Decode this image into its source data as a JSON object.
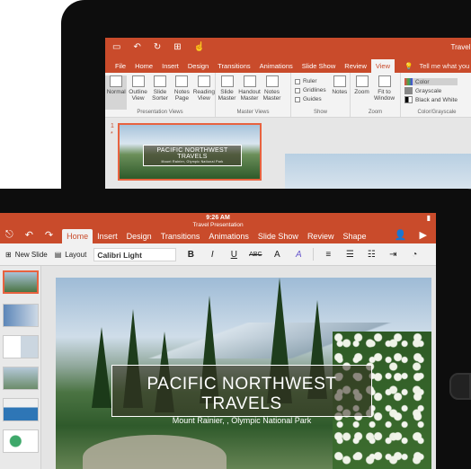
{
  "back": {
    "doc_title": "Travel P",
    "tabs": [
      "File",
      "Home",
      "Insert",
      "Design",
      "Transitions",
      "Animations",
      "Slide Show",
      "Review",
      "View"
    ],
    "active_tab": "View",
    "tell_me": "Tell me what you",
    "groups": {
      "presentation_views": {
        "label": "Presentation Views",
        "commands": [
          "Normal",
          "Outline View",
          "Slide Sorter",
          "Notes Page",
          "Reading View"
        ]
      },
      "master_views": {
        "label": "Master Views",
        "commands": [
          "Slide Master",
          "Handout Master",
          "Notes Master"
        ]
      },
      "show": {
        "label": "Show",
        "checks": [
          "Ruler",
          "Gridlines",
          "Guides"
        ],
        "notes": "Notes"
      },
      "zoom": {
        "label": "Zoom",
        "commands": [
          "Zoom",
          "Fit to Window"
        ]
      },
      "color": {
        "label": "Color/Grayscale",
        "options": [
          "Color",
          "Grayscale",
          "Black and White"
        ]
      }
    },
    "slide_number": "1",
    "slide_star": "*",
    "thumb_title": "PACIFIC NORTHWEST TRAVELS",
    "thumb_subtitle": "Mount Rainier, Olympic National Park"
  },
  "front": {
    "time": "9:26 AM",
    "doc_title": "Travel Presentation",
    "battery": "▮",
    "tabs": [
      "Home",
      "Insert",
      "Design",
      "Transitions",
      "Animations",
      "Slide Show",
      "Review",
      "Shape"
    ],
    "active_tab": "Home",
    "toolbar": {
      "new_slide": "New Slide",
      "layout": "Layout",
      "font": "Calibri Light",
      "bold": "B",
      "italic": "I",
      "underline": "U",
      "strike": "ABC",
      "color": "A",
      "highlight": "A"
    },
    "slide_title": "PACIFIC NORTHWEST TRAVELS",
    "slide_subtitle": "Mount Rainier, , Olympic National Park"
  },
  "colors": {
    "accent": "#c94b2b",
    "selection": "#e8623f"
  }
}
